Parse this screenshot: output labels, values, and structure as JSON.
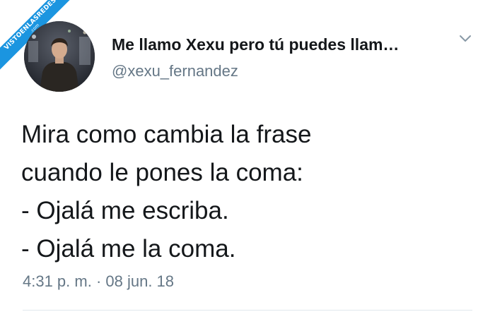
{
  "watermark": {
    "text": "VISTOENLASREDES",
    "sub": ".com"
  },
  "tweet": {
    "display_name": "Me llamo Xexu pero tú puedes llam…",
    "handle": "@xexu_fernandez",
    "lines": [
      "Mira como cambia la frase",
      "cuando le pones la coma:",
      "- Ojalá me escriba.",
      "- Ojalá me la coma."
    ],
    "timestamp": "4:31 p. m. · 08 jun. 18"
  },
  "icons": {
    "menu": "chevron-down-icon",
    "avatar": "profile-photo"
  },
  "colors": {
    "text": "#14171a",
    "secondary": "#657786",
    "accent": "#1b95e0",
    "divider": "#e1e8ed"
  }
}
